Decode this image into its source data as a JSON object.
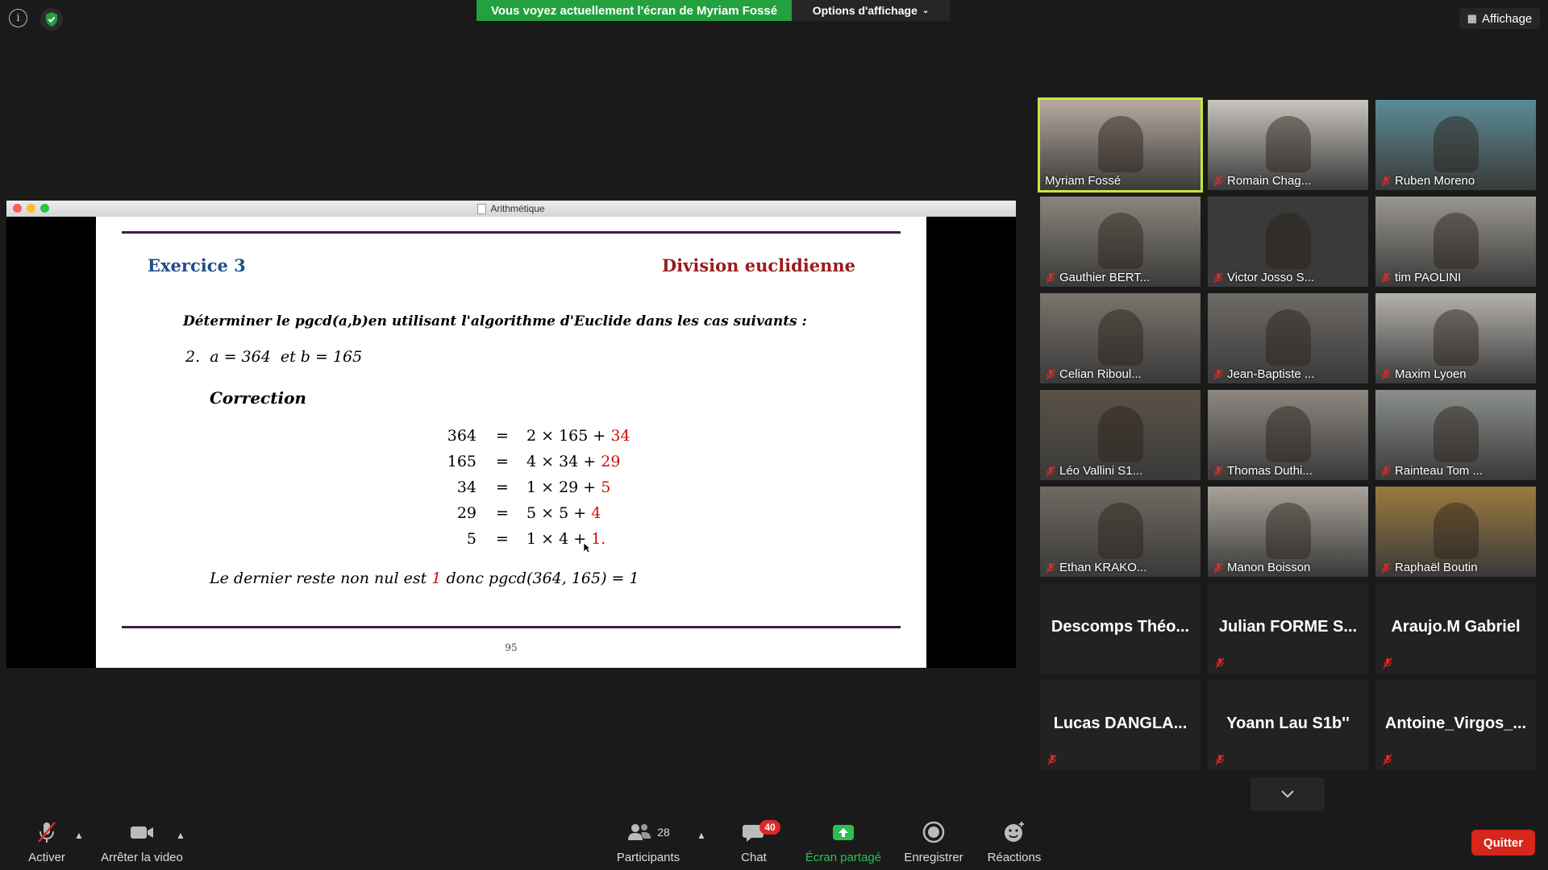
{
  "top": {
    "sharing_banner": "Vous voyez actuellement l'écran de Myriam Fossé",
    "view_options": "Options d'affichage",
    "view_toggle": "Affichage"
  },
  "shared_window": {
    "title": "Arithmétique",
    "slide": {
      "exercise_title": "Exercice 3",
      "topic": "Division euclidienne",
      "instruction": "Déterminer le pgcd(a,b)en utilisant l'algorithme d'Euclide dans les cas suivants :",
      "question": "2.  a = 364  et b = 165",
      "correction_heading": "Correction",
      "equations": [
        {
          "lhs": "364",
          "sign": "=",
          "rhs": "2 × 165 +",
          "rest": "34"
        },
        {
          "lhs": "165",
          "sign": "=",
          "rhs": "4 × 34 +",
          "rest": "29"
        },
        {
          "lhs": "34",
          "sign": "=",
          "rhs": "1 × 29 +",
          "rest": "5"
        },
        {
          "lhs": "29",
          "sign": "=",
          "rhs": "5 × 5 +",
          "rest": "4"
        },
        {
          "lhs": "5",
          "sign": "=",
          "rhs": "1 × 4 +",
          "rest": "1."
        }
      ],
      "conclusion_a": "Le dernier reste non nul est",
      "conclusion_red": "1",
      "conclusion_b": "donc pgcd(364, 165) = 1",
      "page_number": "95"
    }
  },
  "gallery": {
    "video_tiles": [
      {
        "name": "Myriam Fossé",
        "muted": false,
        "active": true,
        "color": "#b8aaa0"
      },
      {
        "name": "Romain Chag...",
        "muted": true,
        "color": "#c9c4bd"
      },
      {
        "name": "Ruben Moreno",
        "muted": true,
        "color": "#5b8c96"
      },
      {
        "name": "Gauthier BERT...",
        "muted": true,
        "color": "#8a857c"
      },
      {
        "name": "Victor Josso S...",
        "muted": true,
        "color": "#3a3a3a"
      },
      {
        "name": "tim PAOLINI",
        "muted": true,
        "color": "#9a9791"
      },
      {
        "name": "Celian Riboul...",
        "muted": true,
        "color": "#7a746c"
      },
      {
        "name": "Jean-Baptiste ...",
        "muted": true,
        "color": "#6e6a66"
      },
      {
        "name": "Maxim Lyoen",
        "muted": true,
        "color": "#b5b2ad"
      },
      {
        "name": "Léo Vallini S1...",
        "muted": true,
        "color": "#5a5246"
      },
      {
        "name": "Thomas Duthi...",
        "muted": true,
        "color": "#8d8780"
      },
      {
        "name": "Rainteau Tom ...",
        "muted": true,
        "color": "#8a8f8c"
      },
      {
        "name": "Ethan KRAKO...",
        "muted": true,
        "color": "#6f6a62"
      },
      {
        "name": "Manon Boisson",
        "muted": true,
        "color": "#a8a29a"
      },
      {
        "name": "Raphaël Boutin",
        "muted": true,
        "color": "#9b7a3e"
      }
    ],
    "name_tiles": [
      {
        "name": "Descomps  Théo...",
        "muted": false
      },
      {
        "name": "Julian FORME S...",
        "muted": true
      },
      {
        "name": "Araujo.M Gabriel",
        "muted": true
      },
      {
        "name": "Lucas DANGLA...",
        "muted": true
      },
      {
        "name": "Yoann Lau S1b''",
        "muted": true
      },
      {
        "name": "Antoine_Virgos_...",
        "muted": true
      }
    ]
  },
  "toolbar": {
    "unmute": "Activer",
    "stop_video": "Arrêter la video",
    "participants": "Participants",
    "participants_count": "28",
    "chat": "Chat",
    "chat_badge": "40",
    "share": "Écran partagé",
    "record": "Enregistrer",
    "reactions": "Réactions",
    "quit": "Quitter"
  },
  "colors": {
    "banner_green": "#23a13e",
    "active_speaker_border": "#c8e63c",
    "quit_red": "#d7261c",
    "slide_title_blue": "#1f4f8a",
    "slide_topic_red": "#9b1c1c"
  }
}
